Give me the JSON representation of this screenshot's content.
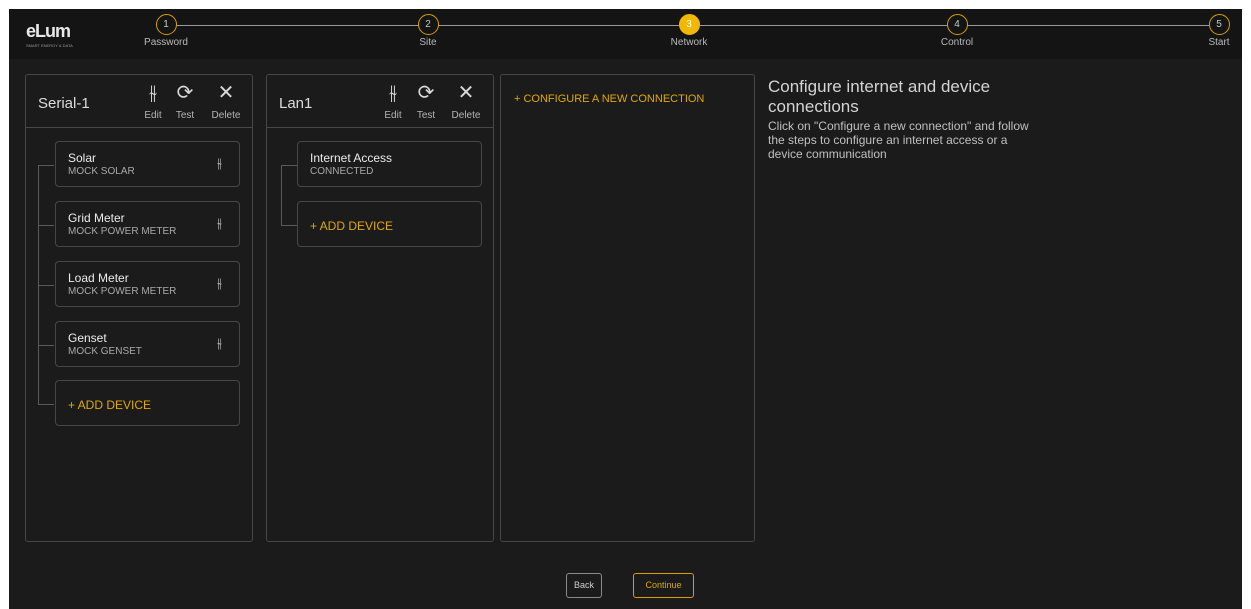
{
  "logo": {
    "text": "eLum",
    "tagline": "SMART ENERGY & DATA"
  },
  "steps": [
    {
      "num": "1",
      "label": "Password"
    },
    {
      "num": "2",
      "label": "Site"
    },
    {
      "num": "3",
      "label": "Network"
    },
    {
      "num": "4",
      "label": "Control"
    },
    {
      "num": "5",
      "label": "Start"
    }
  ],
  "active_step": "3",
  "toolbar": {
    "edit": "Edit",
    "test": "Test",
    "delete": "Delete"
  },
  "icons": {
    "edit": "sliders-icon",
    "test": "refresh-icon",
    "delete": "close-icon",
    "settings": "sliders-icon"
  },
  "serial": {
    "title": "Serial-1",
    "devices": [
      {
        "name": "Solar",
        "status": "MOCK SOLAR"
      },
      {
        "name": "Grid Meter",
        "status": "MOCK POWER METER"
      },
      {
        "name": "Load Meter",
        "status": "MOCK POWER METER"
      },
      {
        "name": "Genset",
        "status": "MOCK GENSET"
      }
    ],
    "add_label": "+ ADD DEVICE"
  },
  "lan": {
    "title": "Lan1",
    "devices": [
      {
        "name": "Internet Access",
        "status": "CONNECTED"
      }
    ],
    "add_label": "+ ADD DEVICE"
  },
  "new_connection": {
    "label": "+ CONFIGURE A NEW CONNECTION"
  },
  "help": {
    "title": "Configure internet and device connections",
    "body": "Click on \"Configure a new connection\" and follow the steps to configure an internet access or a device communication"
  },
  "footer": {
    "back": "Back",
    "continue": "Continue"
  },
  "colors": {
    "accent": "#f2b700",
    "background": "#1b1b1b",
    "border": "#474747"
  }
}
